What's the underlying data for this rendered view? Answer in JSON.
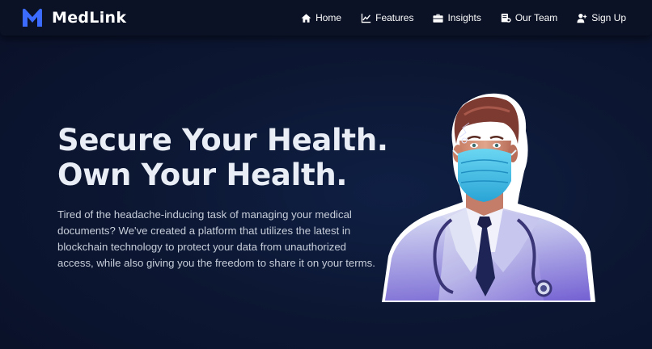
{
  "brand": {
    "name": "MedLink",
    "logo_letter": "M",
    "accent": "#3b6bff"
  },
  "nav": {
    "items": [
      {
        "label": "Home",
        "icon": "home-icon"
      },
      {
        "label": "Features",
        "icon": "chart-line-icon"
      },
      {
        "label": "Insights",
        "icon": "briefcase-icon"
      },
      {
        "label": "Our Team",
        "icon": "team-icon"
      },
      {
        "label": "Sign Up",
        "icon": "user-plus-icon"
      }
    ]
  },
  "hero": {
    "title_line1": "Secure Your Health.",
    "title_line2": "Own Your Health.",
    "description": "Tired of the headache-inducing task of managing your medical documents? We've created a platform that utilizes the latest in blockchain technology to protect your data from unauthorized access, while also giving you the freedom to share it on your terms."
  },
  "colors": {
    "background": "#0c1733",
    "navbar": "#0b1226",
    "mask": "#4fc3e8"
  }
}
